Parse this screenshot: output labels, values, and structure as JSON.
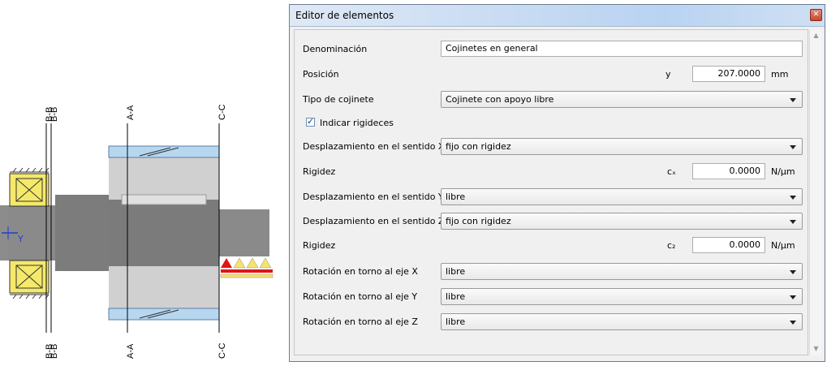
{
  "drawing": {
    "section_labels": [
      "B-B",
      "B-B",
      "A-A",
      "C-C",
      "B-B",
      "B-B",
      "A-A",
      "C-C"
    ],
    "axis_label": "Y"
  },
  "editor": {
    "title": "Editor de elementos",
    "close_icon": "close-icon",
    "fields": {
      "denominacion": {
        "label": "Denominación",
        "value": "Cojinetes en general"
      },
      "posicion": {
        "label": "Posición",
        "symbol": "y",
        "value": "207.0000",
        "unit": "mm"
      },
      "tipo": {
        "label": "Tipo de cojinete",
        "value": "Cojinete con apoyo libre"
      },
      "rigideces": {
        "label": "Indicar rigideces",
        "checked": true
      },
      "desp_x": {
        "label": "Desplazamiento en el sentido X",
        "value": "fijo con rigidez"
      },
      "rigidez_x": {
        "label": "Rigidez",
        "symbol": "cₓ",
        "value": "0.0000",
        "unit": "N/µm"
      },
      "desp_y": {
        "label": "Desplazamiento en el sentido Y",
        "value": "libre"
      },
      "desp_z": {
        "label": "Desplazamiento en el sentido Z",
        "value": "fijo con rigidez"
      },
      "rigidez_z": {
        "label": "Rigidez",
        "symbol": "c₂",
        "value": "0.0000",
        "unit": "N/µm"
      },
      "rot_x": {
        "label": "Rotación en torno al eje X",
        "value": "libre"
      },
      "rot_y": {
        "label": "Rotación en torno al eje Y",
        "value": "libre"
      },
      "rot_z": {
        "label": "Rotación en torno al eje Z",
        "value": "libre"
      }
    }
  }
}
